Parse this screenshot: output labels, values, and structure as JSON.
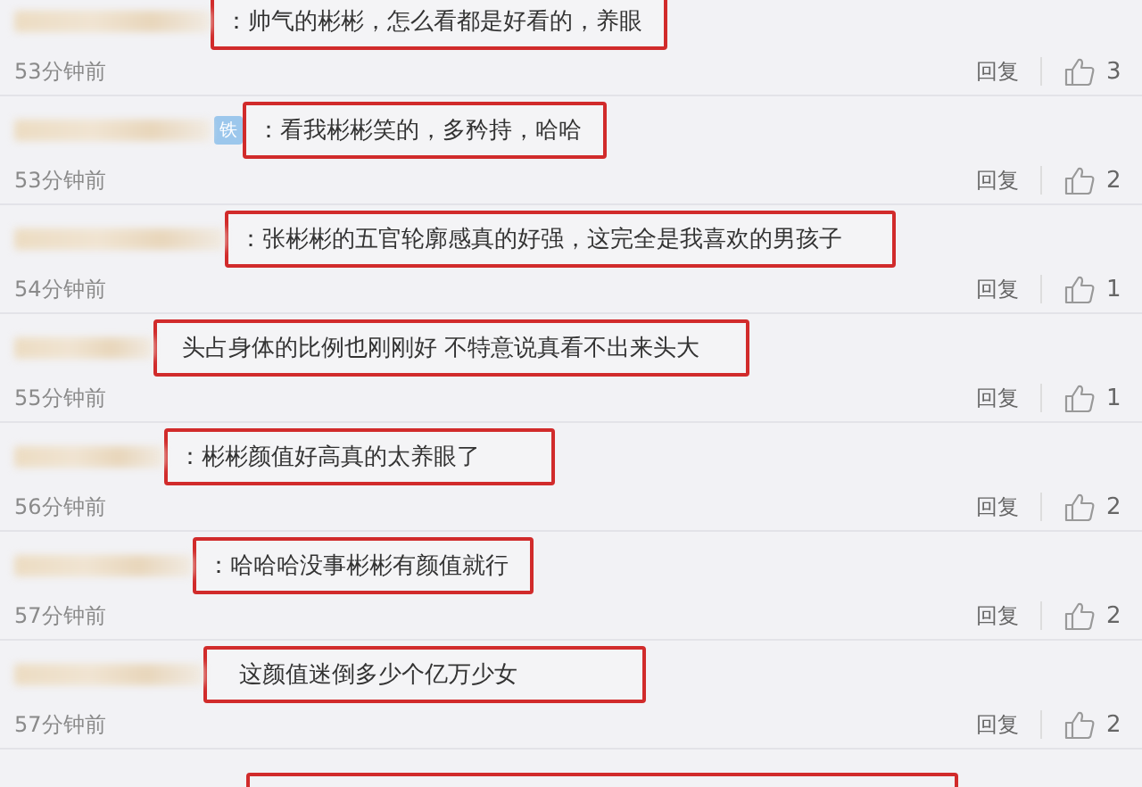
{
  "comments": [
    {
      "text": "：帅气的彬彬，怎么看都是好看的，养眼",
      "time": "53分钟前",
      "reply": "回复",
      "likes": "3"
    },
    {
      "badge": "铁",
      "text": "：看我彬彬笑的，多矜持，哈哈",
      "time": "53分钟前",
      "reply": "回复",
      "likes": "2"
    },
    {
      "text": "：张彬彬的五官轮廓感真的好强，这完全是我喜欢的男孩子",
      "time": "54分钟前",
      "reply": "回复",
      "likes": "1"
    },
    {
      "text": "头占身体的比例也刚刚好 不特意说真看不出来头大",
      "time": "55分钟前",
      "reply": "回复",
      "likes": "1"
    },
    {
      "text": "：彬彬颜值好高真的太养眼了",
      "time": "56分钟前",
      "reply": "回复",
      "likes": "2"
    },
    {
      "text": "：哈哈哈没事彬彬有颜值就行",
      "time": "57分钟前",
      "reply": "回复",
      "likes": "2"
    },
    {
      "text": "这颜值迷倒多少个亿万少女",
      "time": "57分钟前",
      "reply": "回复",
      "likes": "2"
    }
  ]
}
